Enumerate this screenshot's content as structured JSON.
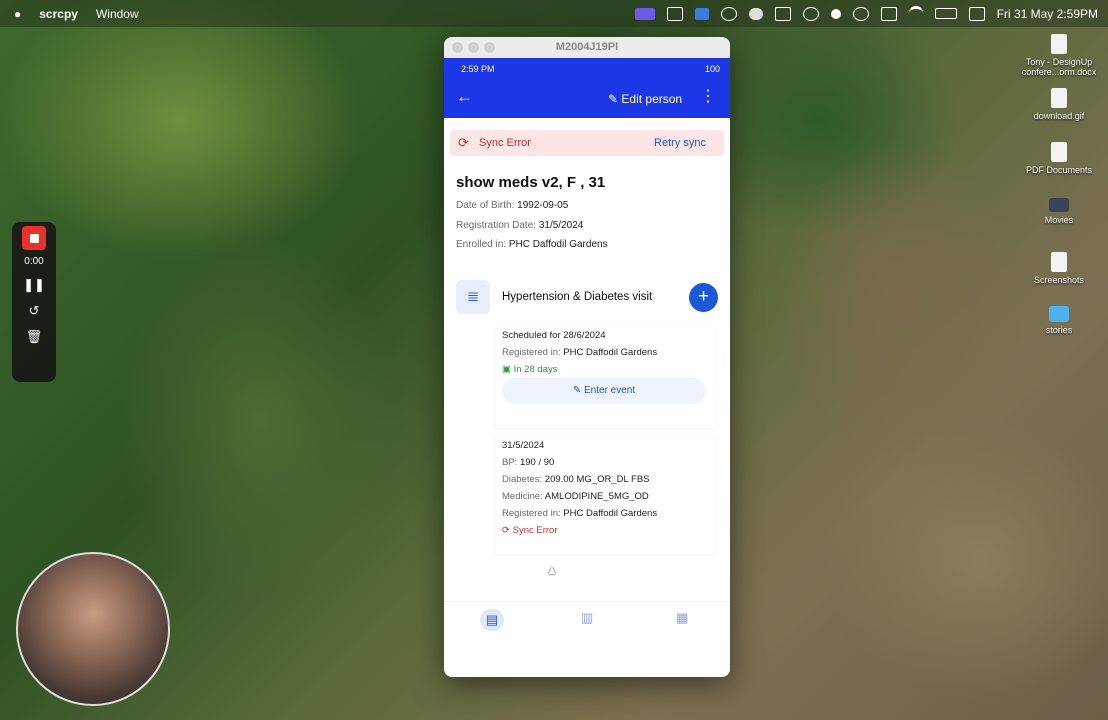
{
  "menubar": {
    "apple": "",
    "app": "scrcpy",
    "menu": "Window",
    "datetime": "Fri 31 May  2:59PM"
  },
  "desktop": {
    "icons": [
      {
        "label": "Tony - DesignUp confere...orm.docx"
      },
      {
        "label": "download.gif"
      },
      {
        "label": "PDF Documents"
      },
      {
        "label": "Movies"
      },
      {
        "label": "Screenshots"
      },
      {
        "label": "stories"
      }
    ]
  },
  "recorder": {
    "time": "0:00"
  },
  "window": {
    "title": "M2004J19PI"
  },
  "phone": {
    "status_time": "2:59 PM",
    "status_right": "100",
    "appbar": {
      "edit_label": "Edit person"
    },
    "sync": {
      "text": "Sync Error",
      "retry": "Retry sync"
    },
    "person": {
      "name": "show meds v2, F , 31",
      "dob_label": "Date of Birth:",
      "dob": "1992-09-05",
      "reg_label": "Registration Date:",
      "reg": "31/5/2024",
      "enrolled_label": "Enrolled in:",
      "enrolled": "PHC Daffodil Gardens"
    },
    "program": {
      "title": "Hypertension & Diabetes visit"
    },
    "scheduled": {
      "title": "Scheduled for 28/6/2024",
      "reg_label": "Registered in:",
      "reg": "PHC Daffodil Gardens",
      "due": "In 28 days",
      "button": "Enter event"
    },
    "event": {
      "date": "31/5/2024",
      "bp_label": "BP:",
      "bp": "190 / 90",
      "diabetes_label": "Diabetes:",
      "diabetes": "209.00 MG_OR_DL FBS",
      "medicine_label": "Medicine:",
      "medicine": "AMLODIPINE_5MG_OD",
      "reg_label": "Registered in:",
      "reg": "PHC Daffodil Gardens",
      "status": "Sync Error"
    }
  }
}
